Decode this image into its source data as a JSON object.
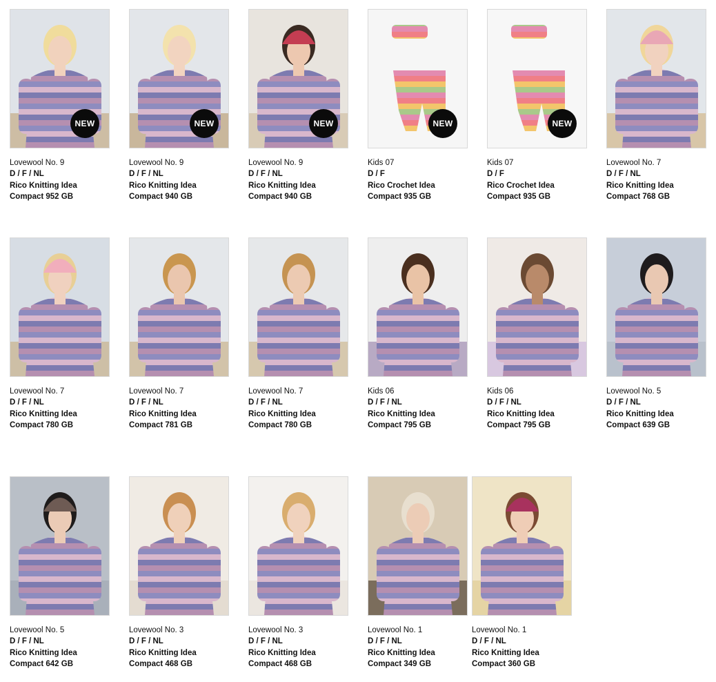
{
  "items": [
    {
      "title": "Lovewool No. 9",
      "langs": "D  / F / NL",
      "idea": "Rico Knitting Idea",
      "compact": "Compact 952 GB",
      "badge": "NEW",
      "bg": "#dfe3e8",
      "ground": "#cdbda4",
      "garment": [
        "#b58fb0",
        "#8e8cbf",
        "#d8b7cc",
        "#7d7bb0"
      ],
      "skin": "#f1d2bd",
      "hair": "#f0dc9c",
      "hat": ""
    },
    {
      "title": "Lovewool No. 9",
      "langs": "D  / F / NL",
      "idea": "Rico Knitting Idea",
      "compact": "Compact 940 GB",
      "badge": "NEW",
      "bg": "#e3e6ea",
      "ground": "#c9b79c",
      "garment": [
        "#c9497b",
        "#6f5ea6",
        "#e48aa6",
        "#3b4a7d"
      ],
      "skin": "#f2d4c0",
      "hair": "#f3e2ad",
      "hat": ""
    },
    {
      "title": "Lovewool No. 9",
      "langs": "D  / F / NL",
      "idea": "Rico Knitting Idea",
      "compact": "Compact 940 GB",
      "badge": "NEW",
      "bg": "#e8e4de",
      "ground": "#d8cbb6",
      "garment": [
        "#f1a0a8",
        "#f0c26b",
        "#8fc6c0",
        "#d76f9a"
      ],
      "skin": "#edc8b0",
      "hair": "#3a2a22",
      "hat": "#c43d52"
    },
    {
      "title": "Kids 07",
      "langs": "D  / F",
      "idea": "Rico Crochet Idea",
      "compact": "Compact 935 GB",
      "badge": "NEW",
      "bg": "#f6f6f6",
      "ground": "#f6f6f6",
      "garment": [
        "#f07f86",
        "#f3c56b",
        "#a9c98a",
        "#e38bb0"
      ],
      "skin": "",
      "hair": "",
      "hat": ""
    },
    {
      "title": "Kids 07",
      "langs": "D  / F",
      "idea": "Rico Crochet Idea",
      "compact": "Compact 935 GB",
      "badge": "NEW",
      "bg": "#f7f7f7",
      "ground": "#f7f7f7",
      "garment": [
        "#b9a3cf",
        "#9fc5e2",
        "#e6a4c1",
        "#c9c3e3"
      ],
      "skin": "",
      "hair": "",
      "hat": ""
    },
    {
      "title": "Lovewool No. 7",
      "langs": "D  / F / NL",
      "idea": "Rico Knitting Idea",
      "compact": "Compact 768 GB",
      "badge": "",
      "bg": "#e2e6ea",
      "ground": "#d8c6a8",
      "garment": [
        "#d9566a",
        "#e98a6c",
        "#c95d7e",
        "#f0a58a"
      ],
      "skin": "#f1d2bf",
      "hair": "#f0d69a",
      "hat": "#e9a7b5"
    },
    {
      "title": "Lovewool No. 7",
      "langs": "D  / F / NL",
      "idea": "Rico Knitting Idea",
      "compact": "Compact 780 GB",
      "badge": "",
      "bg": "#d7dde4",
      "ground": "#cdbfa6",
      "garment": [
        "#b8909a",
        "#8e7d9e",
        "#d1b0a9",
        "#7f6e8c"
      ],
      "skin": "#f0d1bf",
      "hair": "#e8cf96",
      "hat": "#f1aebc"
    },
    {
      "title": "Lovewool No. 7",
      "langs": "D  / F / NL",
      "idea": "Rico Knitting Idea",
      "compact": "Compact 781 GB",
      "badge": "",
      "bg": "#e4e7ea",
      "ground": "#d2c3a9",
      "garment": [
        "#1f6b6b",
        "#2b4f7a",
        "#3d8a72",
        "#1b3f58"
      ],
      "skin": "#eac6ae",
      "hair": "#c9964f",
      "hat": ""
    },
    {
      "title": "Lovewool No. 7",
      "langs": "D  / F / NL",
      "idea": "Rico Knitting Idea",
      "compact": "Compact 780 GB",
      "badge": "",
      "bg": "#e6e8ea",
      "ground": "#d6c8ae",
      "garment": [
        "#3f8f8a",
        "#5d9db4",
        "#2f6e74",
        "#7ab0b7"
      ],
      "skin": "#eccab2",
      "hair": "#c59352",
      "hat": ""
    },
    {
      "title": "Kids 06",
      "langs": "D  / F / NL",
      "idea": "Rico Knitting Idea",
      "compact": "Compact 795 GB",
      "badge": "",
      "bg": "#eeeeee",
      "ground": "#b8aac4",
      "garment": [
        "#1f2340",
        "#e8e2dc",
        "#3c4a6e",
        "#cfc7c0"
      ],
      "skin": "#e9c3a6",
      "hair": "#4a2f1f",
      "hat": ""
    },
    {
      "title": "Kids 06",
      "langs": "D  / F / NL",
      "idea": "Rico Knitting Idea",
      "compact": "Compact 795 GB",
      "badge": "",
      "bg": "#efeae6",
      "ground": "#d8c8e0",
      "garment": [
        "#d9a77e",
        "#f0e6d8",
        "#b77a5a",
        "#e8d7c3"
      ],
      "skin": "#b98a6a",
      "hair": "#6b4a33",
      "hat": ""
    },
    {
      "title": "Lovewool No. 5",
      "langs": "D / F / NL",
      "idea": "Rico Knitting Idea",
      "compact": "Compact 639 GB",
      "badge": "",
      "bg": "#c7ced9",
      "ground": "#b9c1cc",
      "garment": [
        "#e06b5f",
        "#6aa36f",
        "#8f5da8",
        "#e3b55a"
      ],
      "skin": "#e9c8b2",
      "hair": "#1e1b1d",
      "hat": ""
    },
    {
      "title": "Lovewool No. 5",
      "langs": "D / F / NL",
      "idea": "Rico Knitting Idea",
      "compact": "Compact 642 GB",
      "badge": "",
      "bg": "#b9bfc7",
      "ground": "#a9b0ba",
      "garment": [
        "#7da1c8",
        "#9fb8d6",
        "#e9e9ea",
        "#6c8fbb"
      ],
      "skin": "#ebcbb6",
      "hair": "#1f1c1c",
      "hat": "#6e5b54"
    },
    {
      "title": "Lovewool No. 3",
      "langs": "D / F / NL",
      "idea": "Rico Knitting Idea",
      "compact": "Compact 468 GB",
      "badge": "",
      "bg": "#f0ebe4",
      "ground": "#e4dcd1",
      "garment": [
        "#8a6d58",
        "#c9ad92",
        "#5e4a3c",
        "#e0cdb8"
      ],
      "skin": "#efd0b9",
      "hair": "#c98f52",
      "hat": ""
    },
    {
      "title": "Lovewool No. 3",
      "langs": "D / F / NL",
      "idea": "Rico Knitting Idea",
      "compact": "Compact 468 GB",
      "badge": "",
      "bg": "#f3f1ee",
      "ground": "#ebe6e0",
      "garment": [
        "#e2677f",
        "#f0a56c",
        "#c9508e",
        "#f5c27c"
      ],
      "skin": "#f0d2bd",
      "hair": "#d9ad6e",
      "hat": ""
    },
    {
      "title": "Lovewool No. 1",
      "langs": "D / F / NL",
      "idea": "Rico Knitting Idea",
      "compact": "Compact 349 GB",
      "badge": "",
      "bg": "#d8cbb5",
      "ground": "#7b6d5c",
      "garment": [
        "#3b3f9a",
        "#7e3f9c",
        "#2c6fb0",
        "#5b2d7a"
      ],
      "skin": "#ecccb6",
      "hair": "#e8dfcf",
      "hat": ""
    },
    {
      "title": "Lovewool No. 1",
      "langs": "D / F / NL",
      "idea": "Rico Knitting Idea",
      "compact": "Compact 360 GB",
      "badge": "",
      "bg": "#efe4c6",
      "ground": "#e5d4a4",
      "garment": [
        "#b8236a",
        "#e5773d",
        "#7a2a8e",
        "#e9b24a"
      ],
      "skin": "#efcdb6",
      "hair": "#7b4a33",
      "hat": "#a8325e"
    }
  ]
}
